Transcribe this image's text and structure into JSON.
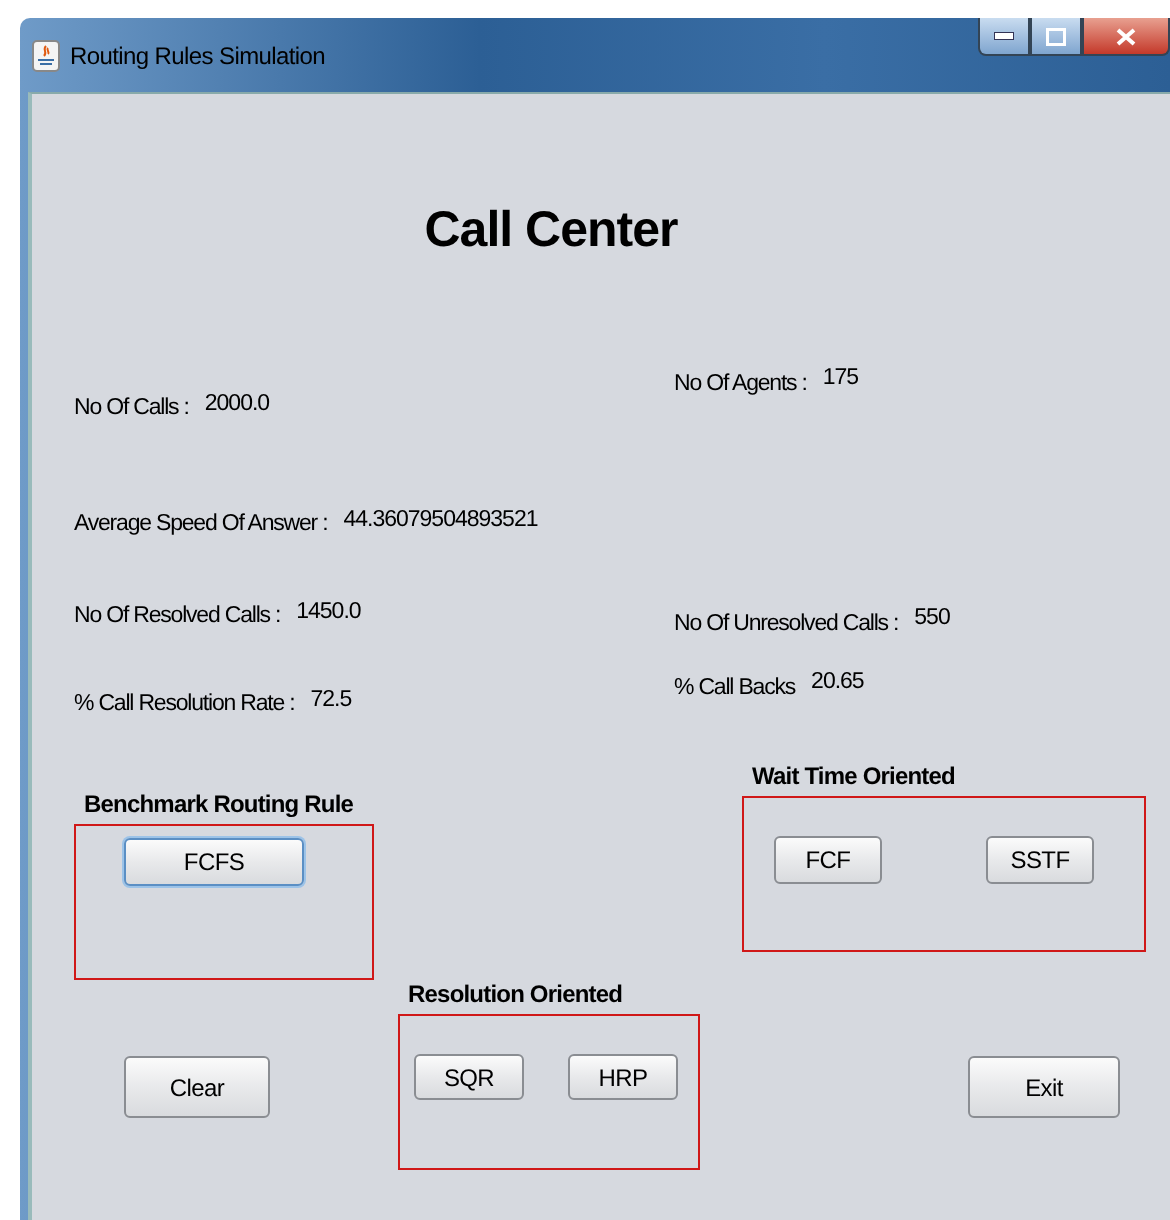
{
  "window": {
    "title": "Routing Rules  Simulation"
  },
  "heading": "Call Center",
  "stat_rows": [
    {
      "left": {
        "label": "No Of Calls :",
        "value": "2000.0"
      },
      "right": {
        "label": "No Of Agents :",
        "value": "175"
      }
    },
    {
      "left": {
        "label": "Average Speed Of Answer :",
        "value": "44.36079504893521"
      }
    },
    {
      "left": {
        "label": "No Of  Resolved Calls :",
        "value": "1450.0"
      },
      "right": {
        "label": "No Of Unresolved Calls :",
        "value": "550"
      }
    },
    {
      "left": {
        "label": "% Call Resolution Rate :",
        "value": "72.5"
      },
      "right": {
        "label": "% Call Backs",
        "value": "20.65"
      }
    }
  ],
  "groups": [
    {
      "title": "Benchmark Routing Rule",
      "buttons": [
        {
          "label": "FCFS",
          "focused": true
        }
      ]
    },
    {
      "title": "Wait Time Oriented",
      "buttons": [
        {
          "label": "FCF",
          "focused": false
        },
        {
          "label": "SSTF",
          "focused": false
        }
      ]
    },
    {
      "title": "Resolution Oriented",
      "buttons": [
        {
          "label": "SQR",
          "focused": false
        },
        {
          "label": "HRP",
          "focused": false
        }
      ]
    }
  ],
  "buttons": [
    {
      "label": "Clear",
      "focused": false
    },
    {
      "label": "Exit",
      "focused": false
    }
  ]
}
